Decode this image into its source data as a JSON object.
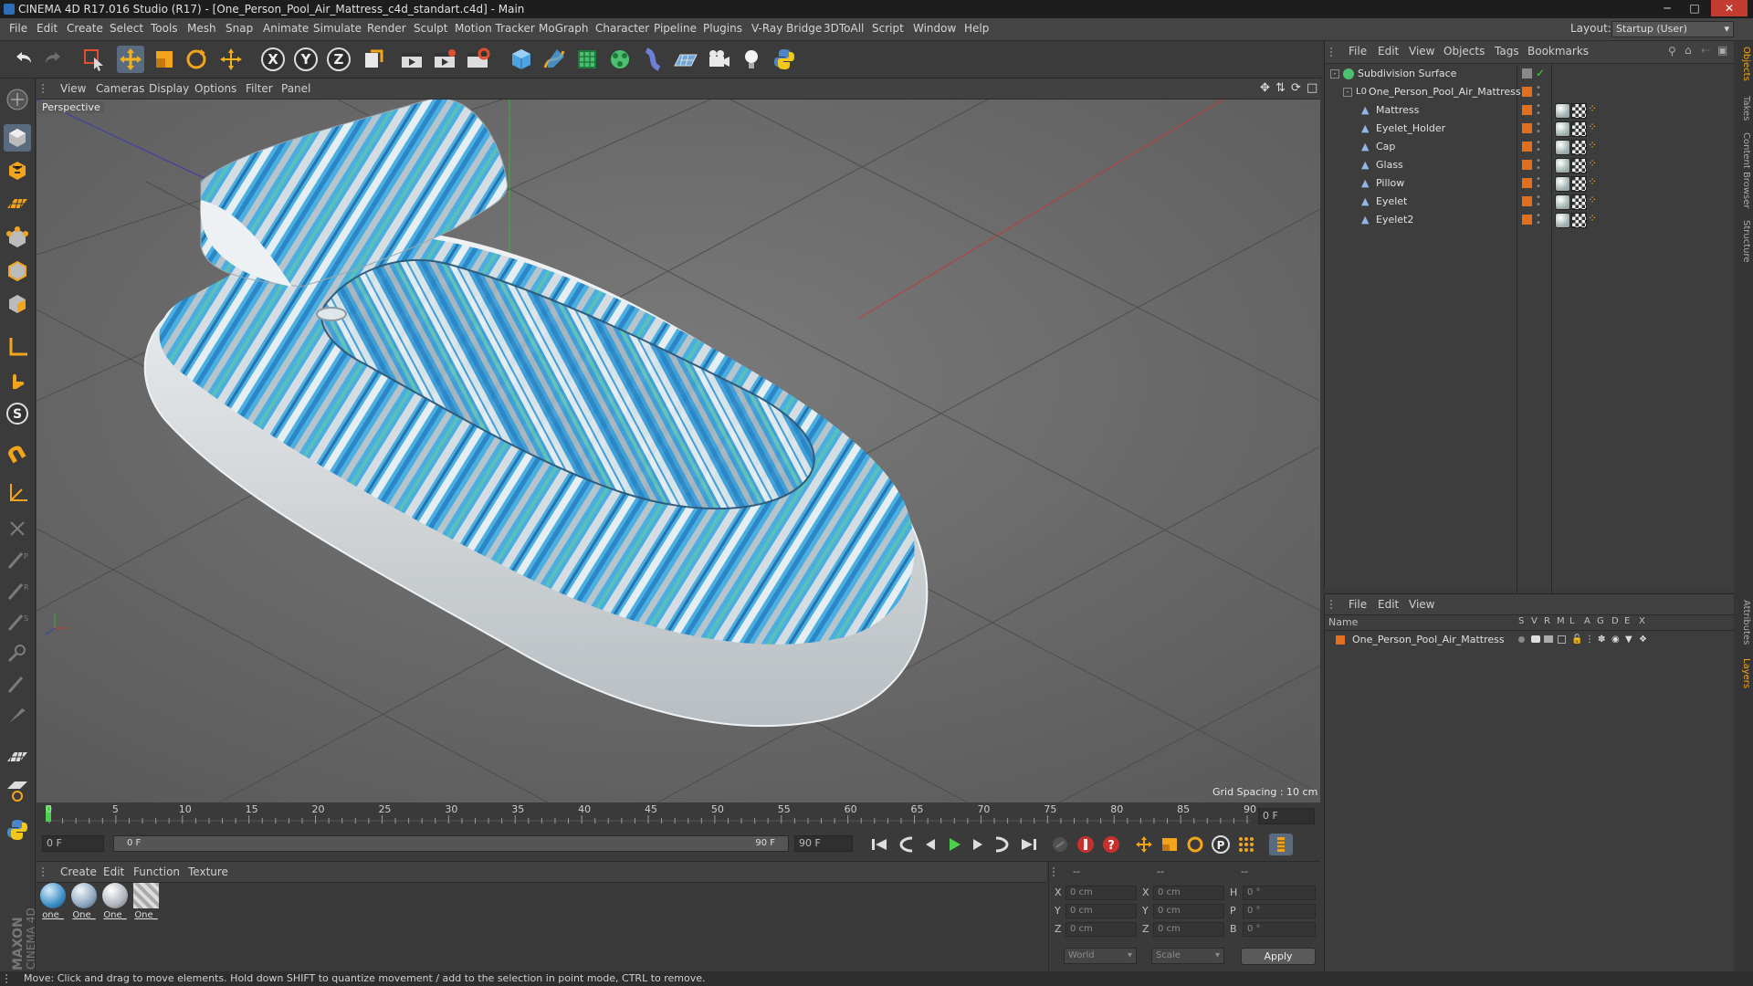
{
  "window": {
    "title": "CINEMA 4D R17.016 Studio (R17) - [One_Person_Pool_Air_Mattress_c4d_standart.c4d] - Main",
    "minimize_icon": "minimize-icon",
    "maximize_icon": "maximize-icon",
    "close_icon": "close-icon"
  },
  "menubar": {
    "items": [
      "File",
      "Edit",
      "Create",
      "Select",
      "Tools",
      "Mesh",
      "Snap",
      "Animate",
      "Simulate",
      "Render",
      "Sculpt",
      "Motion Tracker",
      "MoGraph",
      "Character",
      "Pipeline",
      "Plugins",
      "V-Ray Bridge",
      "3DToAll",
      "Script",
      "Window",
      "Help"
    ],
    "layout_label": "Layout:",
    "layout_value": "Startup (User)"
  },
  "toolbar": {
    "icons": [
      "undo-icon",
      "redo-icon",
      "live-selection-icon",
      "move-icon",
      "scale-icon",
      "rotate-icon",
      "transform-icon",
      "x-axis-icon",
      "y-axis-icon",
      "z-axis-icon",
      "coordinate-system-icon",
      "render-view-icon",
      "render-picture-viewer-icon",
      "edit-render-settings-icon",
      "cube-icon",
      "pen-spline-icon",
      "subdivision-icon",
      "cloner-icon",
      "deformer-icon",
      "floor-icon",
      "camera-icon",
      "light-icon",
      "python-icon"
    ]
  },
  "viewport": {
    "menu": [
      "View",
      "Cameras",
      "Display",
      "Options",
      "Filter",
      "Panel"
    ],
    "camera_label": "Perspective",
    "grid_spacing": "Grid Spacing : 10 cm"
  },
  "timeline": {
    "ticks": [
      "0",
      "5",
      "10",
      "15",
      "20",
      "25",
      "30",
      "35",
      "40",
      "45",
      "50",
      "55",
      "60",
      "65",
      "70",
      "75",
      "80",
      "85",
      "90"
    ],
    "current_frame_field": "0 F",
    "start_field": "0 F",
    "range_start": "0 F",
    "range_end": "90 F",
    "end_field": "90 F"
  },
  "material_manager": {
    "menu": [
      "Create",
      "Edit",
      "Function",
      "Texture"
    ],
    "materials": [
      {
        "label": "one_",
        "color": "#3e8fc8"
      },
      {
        "label": "One_",
        "color": "#8ea8c0"
      },
      {
        "label": "One_",
        "color": "#b0b6bd"
      },
      {
        "label": "One_",
        "color": "#c8c8c8"
      }
    ]
  },
  "coordinates": {
    "headers": [
      "--",
      "--",
      "--"
    ],
    "rows": [
      {
        "l1": "X",
        "v1": "0 cm",
        "l2": "X",
        "v2": "0 cm",
        "l3": "H",
        "v3": "0 °"
      },
      {
        "l1": "Y",
        "v1": "0 cm",
        "l2": "Y",
        "v2": "0 cm",
        "l3": "P",
        "v3": "0 °"
      },
      {
        "l1": "Z",
        "v1": "0 cm",
        "l2": "Z",
        "v2": "0 cm",
        "l3": "B",
        "v3": "0 °"
      }
    ],
    "space_select": "World",
    "mode_select": "Scale",
    "apply_label": "Apply"
  },
  "object_manager": {
    "menu": [
      "File",
      "Edit",
      "View",
      "Objects",
      "Tags",
      "Bookmarks"
    ],
    "objects": [
      {
        "name": "Subdivision Surface",
        "level": 0
      },
      {
        "name": "One_Person_Pool_Air_Mattress",
        "level": 1
      },
      {
        "name": "Mattress",
        "level": 2
      },
      {
        "name": "Eyelet_Holder",
        "level": 2
      },
      {
        "name": "Cap",
        "level": 2
      },
      {
        "name": "Glass",
        "level": 2
      },
      {
        "name": "Pillow",
        "level": 2
      },
      {
        "name": "Eyelet",
        "level": 2
      },
      {
        "name": "Eyelet2",
        "level": 2
      }
    ]
  },
  "layer_manager": {
    "menu": [
      "File",
      "Edit",
      "View"
    ],
    "columns": [
      "Name",
      "S",
      "V",
      "R",
      "M",
      "L",
      "A",
      "G",
      "D",
      "E",
      "X"
    ],
    "layers": [
      {
        "name": "One_Person_Pool_Air_Mattress",
        "color": "#e07020"
      }
    ]
  },
  "right_tabs": [
    "Objects",
    "Takes",
    "Content Browser",
    "Structure",
    "Attributes",
    "Layers"
  ],
  "brand": {
    "line1": "MAXON",
    "line2": "CINEMA 4D"
  },
  "status": "Move: Click and drag to move elements. Hold down SHIFT to quantize movement / add to the selection in point mode, CTRL to remove.",
  "colors": {
    "accent": "#3d8fd6",
    "object_tag": "#e07020",
    "mattress_blue": "#3aa0d8"
  }
}
